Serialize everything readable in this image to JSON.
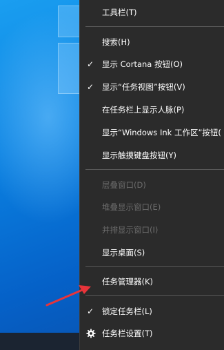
{
  "menu": {
    "toolbars": "工具栏(T)",
    "search": "搜索(H)",
    "show_cortana": "显示 Cortana 按钮(O)",
    "show_task_view": "显示“任务视图”按钮(V)",
    "show_people": "在任务栏上显示人脉(P)",
    "show_ink": "显示“Windows Ink 工作区”按钮(",
    "show_touch_keyboard": "显示触摸键盘按钮(Y)",
    "cascade": "层叠窗口(D)",
    "stacked": "堆叠显示窗口(E)",
    "side_by_side": "并排显示窗口(I)",
    "show_desktop": "显示桌面(S)",
    "task_manager": "任务管理器(K)",
    "lock_taskbar": "锁定任务栏(L)",
    "taskbar_settings": "任务栏设置(T)"
  },
  "icons": {
    "check": "✓",
    "settings": "gear-icon",
    "arrow": "red-arrow-icon"
  },
  "colors": {
    "menu_bg": "#2b2b2b",
    "text": "#ffffff",
    "disabled_text": "#6d6d6d",
    "arrow": "#e8343a"
  }
}
